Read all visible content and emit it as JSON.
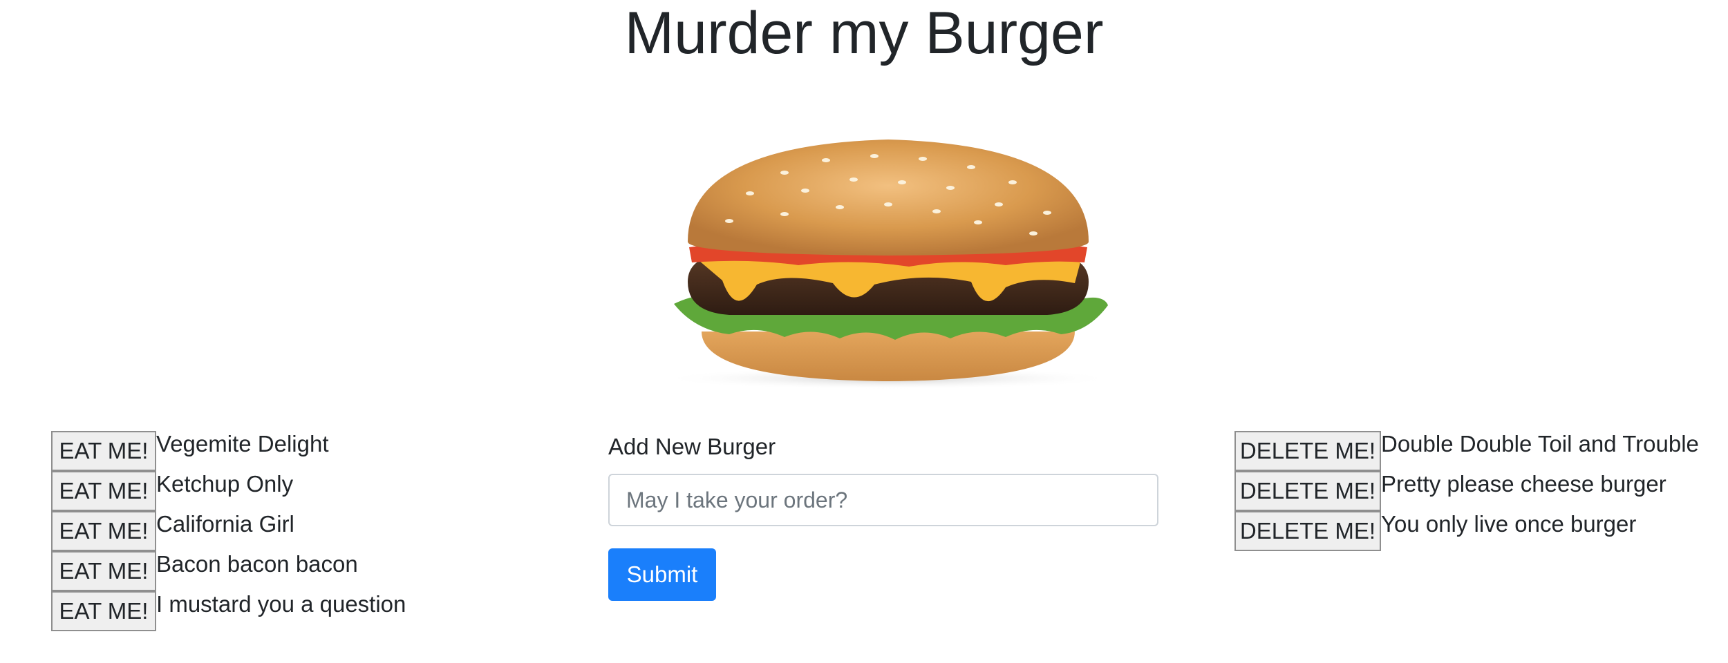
{
  "header": {
    "title": "Murder my Burger"
  },
  "hero": {
    "image": "burger-image"
  },
  "uneaten": {
    "button_label": "EAT ME!",
    "burgers": [
      "Vegemite Delight",
      "Ketchup Only",
      "California Girl",
      "Bacon bacon bacon",
      "I mustard you a question"
    ]
  },
  "form": {
    "label": "Add New Burger",
    "input_value": "",
    "placeholder": "May I take your order?",
    "submit_label": "Submit"
  },
  "eaten": {
    "button_label": "DELETE ME!",
    "burgers": [
      "Double Double Toil and Trouble",
      "Pretty please cheese burger",
      "You only live once burger"
    ]
  },
  "colors": {
    "primary": "#1a7ffb",
    "text": "#212529"
  }
}
